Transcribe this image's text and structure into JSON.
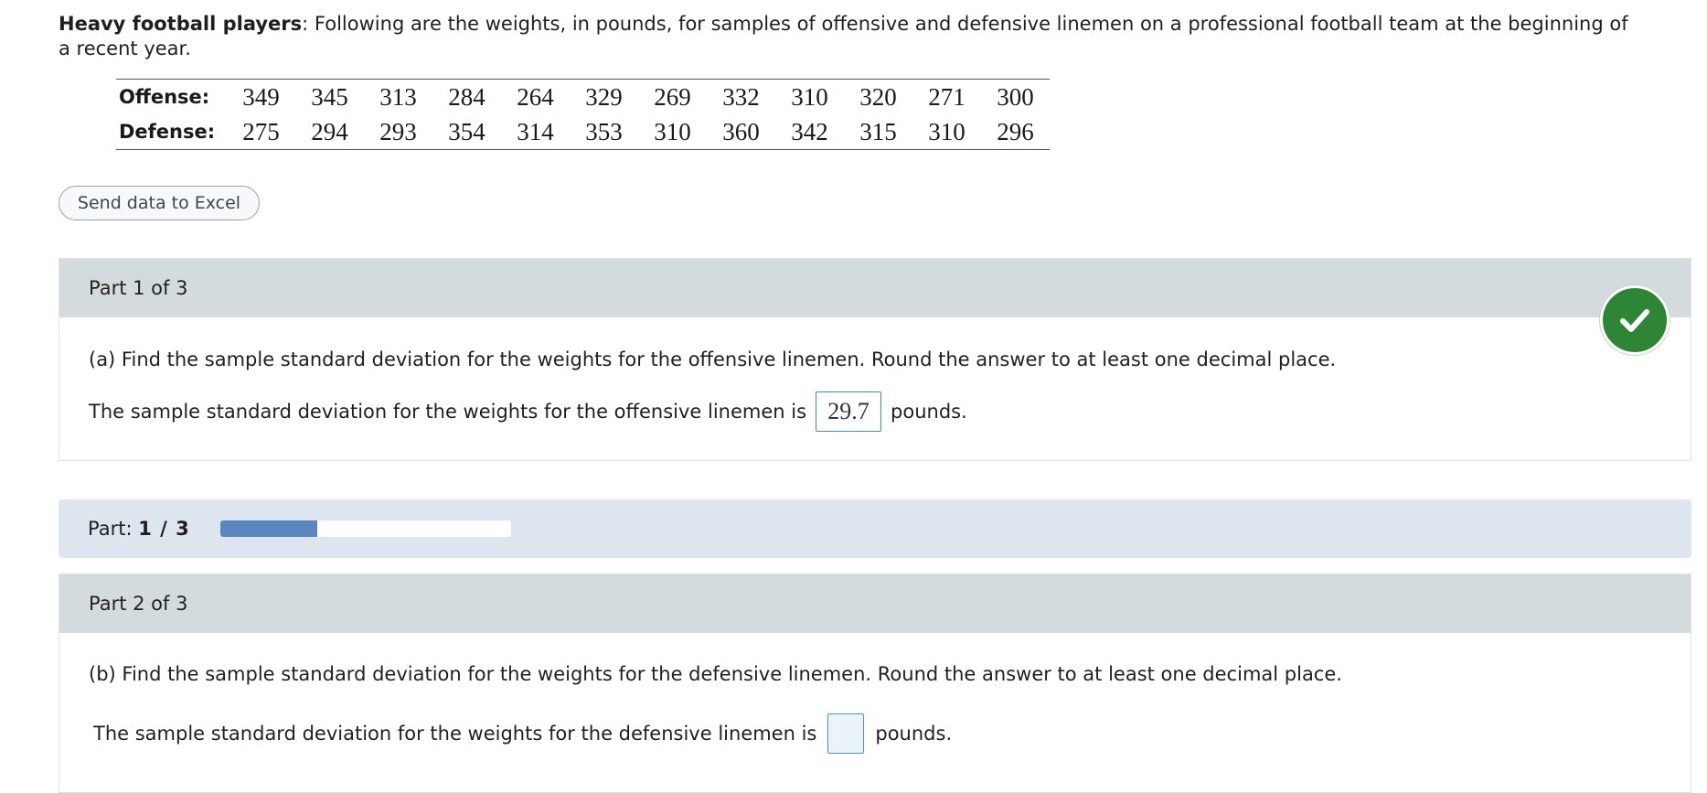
{
  "problem": {
    "title": "Heavy football players",
    "text": ": Following are the weights, in pounds, for samples of offensive and defensive linemen on a professional football team at the beginning of a recent year."
  },
  "table": {
    "rows": [
      {
        "label": "Offense:",
        "values": [
          "349",
          "345",
          "313",
          "284",
          "264",
          "329",
          "269",
          "332",
          "310",
          "320",
          "271",
          "300"
        ]
      },
      {
        "label": "Defense:",
        "values": [
          "275",
          "294",
          "293",
          "354",
          "314",
          "353",
          "310",
          "360",
          "342",
          "315",
          "310",
          "296"
        ]
      }
    ]
  },
  "excel_button": "Send data to Excel",
  "part1": {
    "header": "Part 1 of 3",
    "question": "(a) Find the sample standard deviation for the weights for the offensive linemen. Round the answer to at least one decimal place.",
    "answer_prefix": "The sample standard deviation for the weights for the offensive linemen is",
    "answer_value": "29.7",
    "answer_suffix": "pounds.",
    "status_icon": "checkmark-icon",
    "status_color": "#2e8536"
  },
  "progress": {
    "label": "Part:",
    "value_text": "1 / 3",
    "fraction": 0.333,
    "fill_color": "#5a85bf"
  },
  "part2": {
    "header": "Part 2 of 3",
    "question": "(b) Find the sample standard deviation for the weights for the defensive linemen. Round the answer to at least one decimal place.",
    "answer_prefix": "The sample standard deviation for the weights for the defensive linemen is",
    "answer_value": "",
    "answer_suffix": "pounds."
  }
}
